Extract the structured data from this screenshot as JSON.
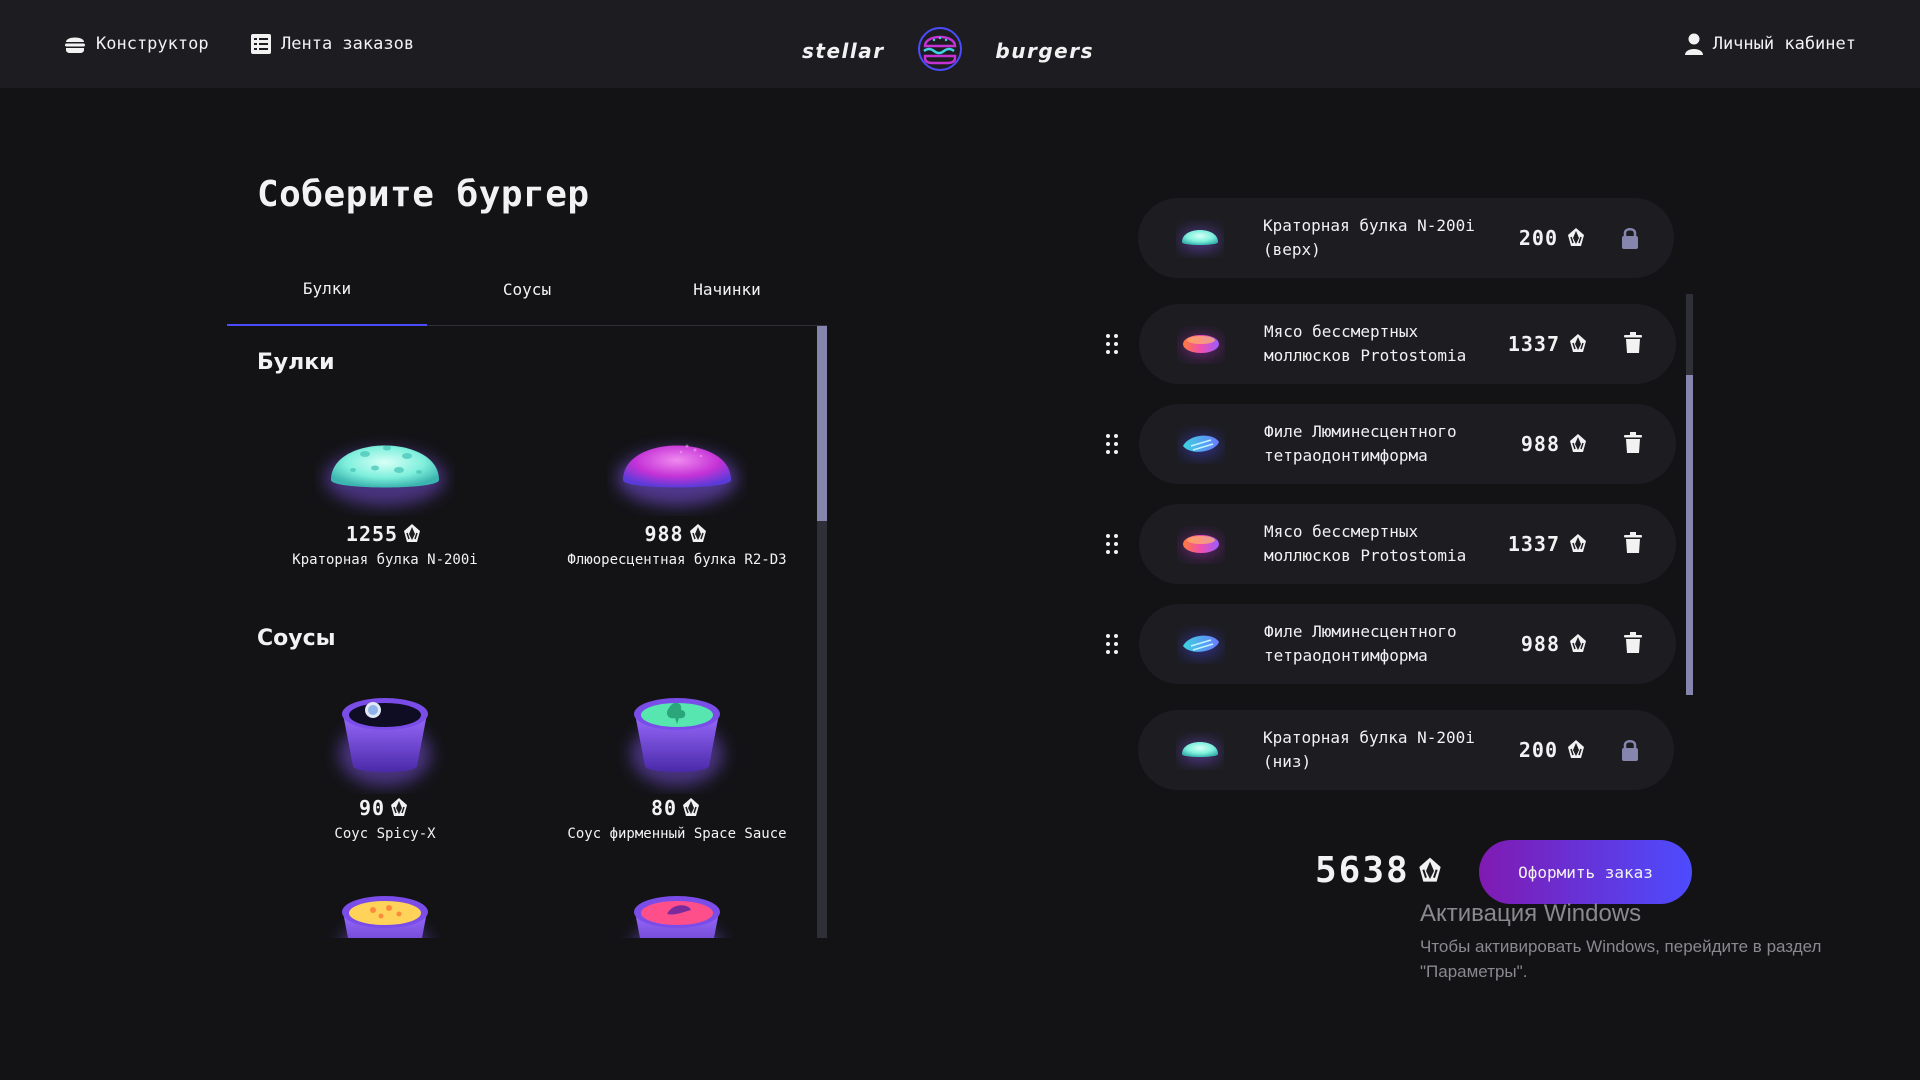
{
  "header": {
    "nav": [
      {
        "label": "Конструктор",
        "icon": "burger-icon"
      },
      {
        "label": "Лента заказов",
        "icon": "list-icon"
      }
    ],
    "logo": {
      "left": "stellar",
      "right": "burgers"
    },
    "account": {
      "label": "Личный кабинет",
      "icon": "profile-icon"
    }
  },
  "main": {
    "title": "Соберите бургер",
    "tabs": [
      {
        "label": "Булки",
        "active": true
      },
      {
        "label": "Соусы",
        "active": false
      },
      {
        "label": "Начинки",
        "active": false
      }
    ],
    "sections": [
      {
        "title": "Булки",
        "items": [
          {
            "name": "Краторная булка N-200i",
            "price": "1255"
          },
          {
            "name": "Флюоресцентная булка R2-D3",
            "price": "988"
          }
        ]
      },
      {
        "title": "Соусы",
        "items": [
          {
            "name": "Соус Spicy-X",
            "price": "90"
          },
          {
            "name": "Соус фирменный Space Sauce",
            "price": "80"
          }
        ]
      }
    ]
  },
  "constructor": {
    "top": {
      "name": "Краторная булка N-200i (верх)",
      "price": "200",
      "locked": true
    },
    "fillings": [
      {
        "name": "Мясо бессмертных моллюсков Protostomia",
        "price": "1337",
        "kind": "meat"
      },
      {
        "name": "Филе Люминесцентного тетраодонтимформа",
        "price": "988",
        "kind": "fish"
      },
      {
        "name": "Мясо бессмертных моллюсков Protostomia",
        "price": "1337",
        "kind": "meat"
      },
      {
        "name": "Филе Люминесцентного тетраодонтимформа",
        "price": "988",
        "kind": "fish"
      }
    ],
    "bottom": {
      "name": "Краторная булка N-200i (низ)",
      "price": "200",
      "locked": true
    },
    "total": "5638",
    "order_button": "Оформить заказ"
  },
  "watermark": {
    "title": "Активация Windows",
    "line1": "Чтобы активировать Windows, перейдите в раздел",
    "line2": "\"Параметры\"."
  },
  "colors": {
    "background": "#131316",
    "panel": "#1c1c21",
    "accent": "#4c4cff",
    "accent_purple": "#801ab2",
    "scrollbar": "#8585ad"
  }
}
